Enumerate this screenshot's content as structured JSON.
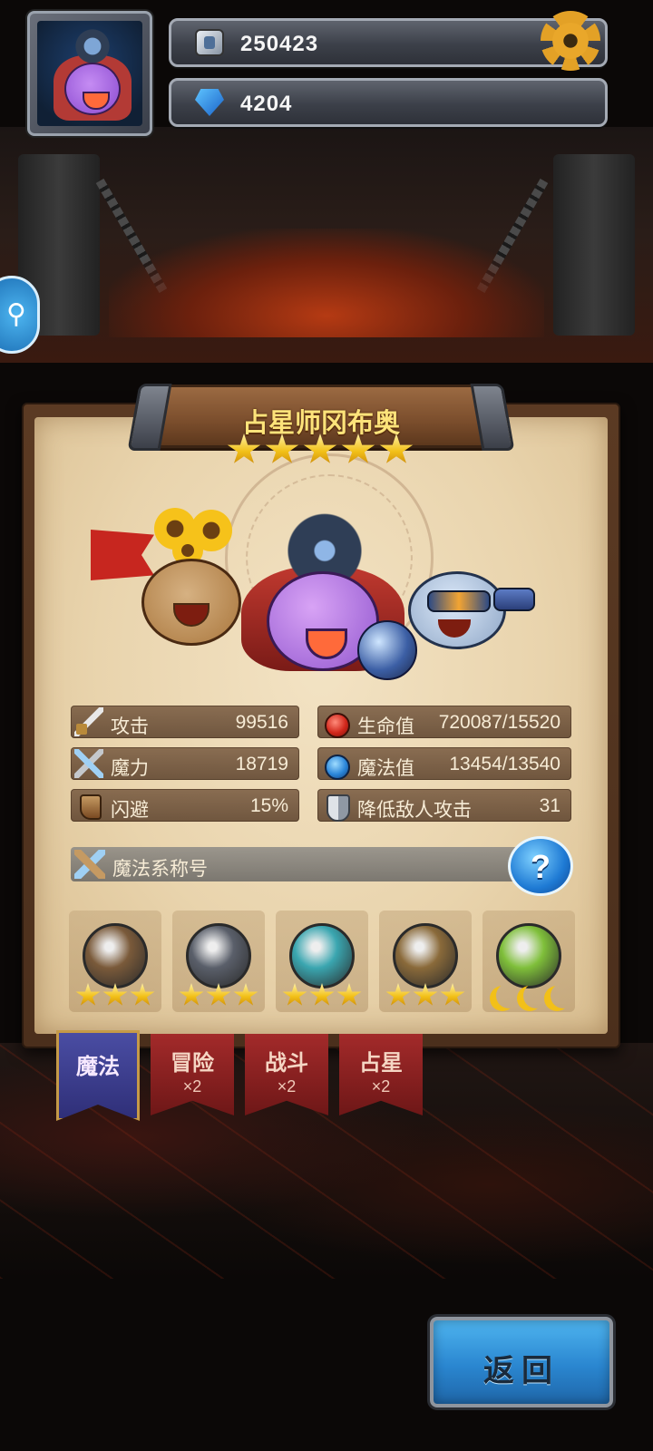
{
  "hud": {
    "gold_value": "250423",
    "gem_value": "4204",
    "icons": {
      "gold": "coin-chest-icon",
      "gem": "blue-gem-icon",
      "settings": "gear-icon",
      "side": "magnifier-icon"
    },
    "colors": {
      "gear": "#e3a126",
      "gem": "#2a86d9"
    }
  },
  "hero": {
    "name": "占星师冈布奥",
    "star_count": 5
  },
  "stats": {
    "attack": {
      "label": "攻击",
      "value": "99516"
    },
    "magic_power": {
      "label": "魔力",
      "value": "18719"
    },
    "dodge": {
      "label": "闪避",
      "value": "15%"
    },
    "hp": {
      "label": "生命值",
      "value": "720087/15520"
    },
    "mp": {
      "label": "魔法值",
      "value": "13454/13540"
    },
    "enemy_attack_reduction": {
      "label": "降低敌人攻击",
      "value": "31"
    }
  },
  "title_row": {
    "label": "魔法系称号",
    "help": "?"
  },
  "badges": [
    {
      "icon": "horn-crest-icon",
      "stars": 3,
      "color": "#7a5a3a"
    },
    {
      "icon": "sword-shield-icon",
      "stars": 3,
      "color": "#5a5f6a"
    },
    {
      "icon": "chalice-crest-icon",
      "stars": 3,
      "color": "#3aa6b0"
    },
    {
      "icon": "laurel-rock-icon",
      "stars": 3,
      "color": "#8a6a3a"
    },
    {
      "icon": "crown-portal-icon",
      "moons": 3,
      "color": "#7fbf3a"
    }
  ],
  "tabs": [
    {
      "name": "魔法",
      "count": "",
      "active": true
    },
    {
      "name": "冒险",
      "count": "×2",
      "active": false
    },
    {
      "name": "战斗",
      "count": "×2",
      "active": false
    },
    {
      "name": "占星",
      "count": "×2",
      "active": false
    }
  ],
  "back_button": {
    "label": "返回"
  }
}
